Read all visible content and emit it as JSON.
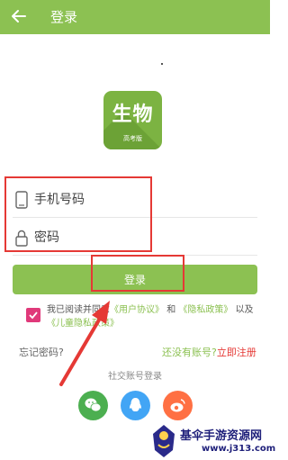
{
  "header": {
    "title": "登录"
  },
  "logo": {
    "main": "生物",
    "sub": "高考版"
  },
  "form": {
    "phone_placeholder": "手机号码",
    "password_placeholder": "密码",
    "login_label": "登录"
  },
  "agreement": {
    "checked": true,
    "prefix": "我已阅读并同意",
    "user_link": "《用户协议》",
    "and": "和",
    "privacy_link": "《隐私政策》",
    "also": "以及",
    "child_link": "《儿童隐私政策》"
  },
  "links": {
    "forgot": "忘记密码?",
    "no_account": "还没有账号?",
    "register": "立即注册"
  },
  "social": {
    "title": "社交账号登录",
    "items": [
      {
        "name": "wechat",
        "icon": "wechat-icon",
        "color": "#4caf50"
      },
      {
        "name": "qq",
        "icon": "qq-icon",
        "color": "#42a5f5"
      },
      {
        "name": "weibo",
        "icon": "weibo-icon",
        "color": "#ff7043"
      }
    ]
  },
  "watermark": {
    "title": "基伞手游资源网",
    "url": "www.j313.com"
  },
  "colors": {
    "primary": "#8cc152",
    "annotation": "#e53935",
    "checkbox": "#e0397a"
  }
}
